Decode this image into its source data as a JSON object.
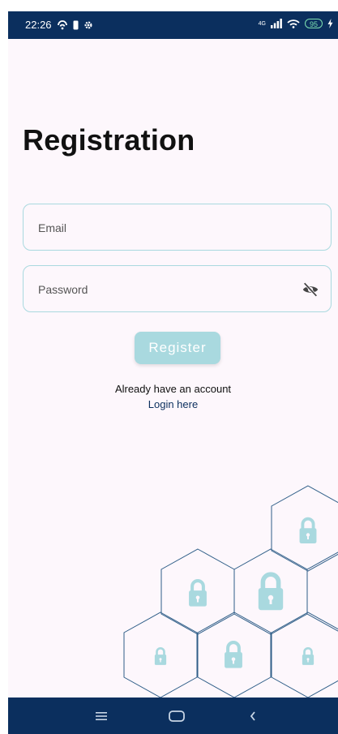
{
  "status_bar": {
    "time": "22:26",
    "network": "4G",
    "battery": "95"
  },
  "page": {
    "title": "Registration"
  },
  "form": {
    "email_placeholder": "Email",
    "email_value": "",
    "password_placeholder": "Password",
    "password_value": "",
    "register_label": "Register"
  },
  "footer_links": {
    "prompt": "Already have an account",
    "login_label": "Login here"
  },
  "colors": {
    "primary": "#0b2f5e",
    "accent": "#a9d9df",
    "background": "#fdf7fc"
  },
  "icons": {
    "password_toggle": "eye-off-icon",
    "decoration": "padlock-icon",
    "nav": [
      "menu-icon",
      "home-icon",
      "back-icon"
    ]
  }
}
